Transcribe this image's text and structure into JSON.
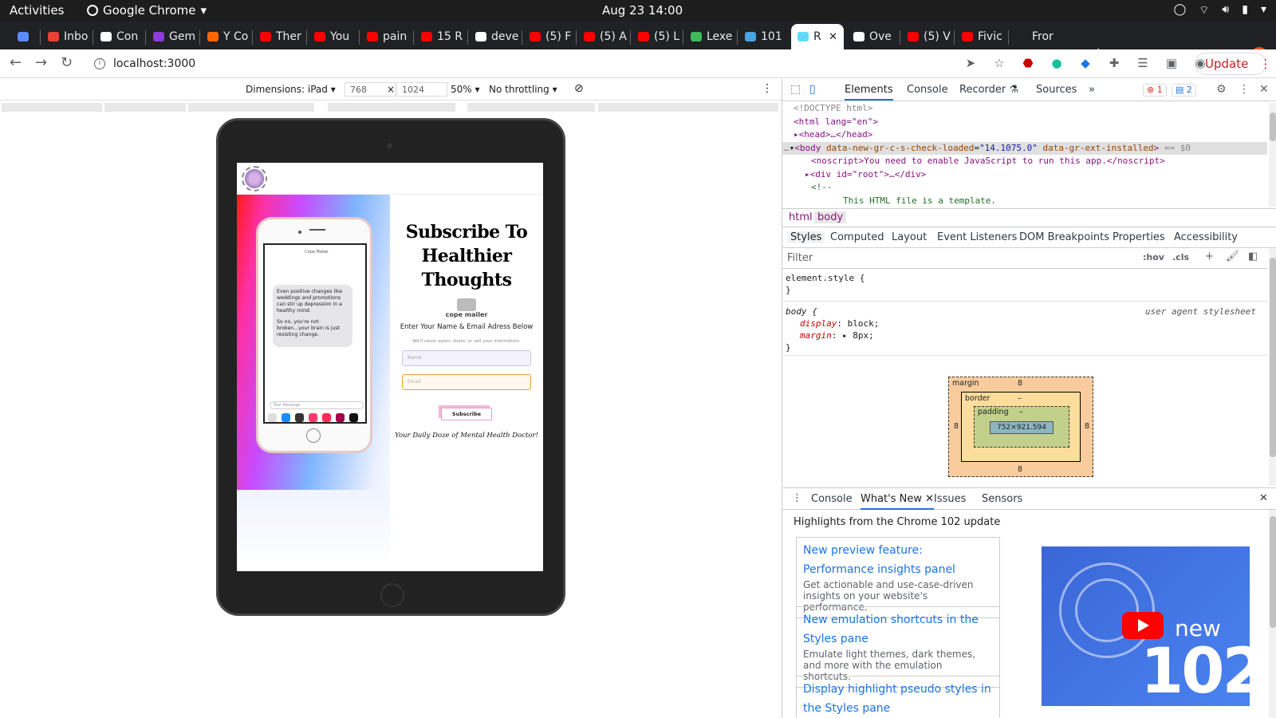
{
  "topbar": {
    "activities": "Activities",
    "app": "Google Chrome",
    "clock": "Aug 23  14:00"
  },
  "tabs": [
    {
      "label": "",
      "color": "#5a8cff"
    },
    {
      "label": "Inbo",
      "color": "#ea4335"
    },
    {
      "label": "Con",
      "color": "#ffffff"
    },
    {
      "label": "Gem",
      "color": "#8e3bd8"
    },
    {
      "label": "Y Co",
      "color": "#ff6600"
    },
    {
      "label": "Ther",
      "color": "#ff0000"
    },
    {
      "label": "You",
      "color": "#ff0000"
    },
    {
      "label": "pain",
      "color": "#ff0000"
    },
    {
      "label": "15 R",
      "color": "#ff0000"
    },
    {
      "label": "deve",
      "color": "#ffffff"
    },
    {
      "label": "(5) F",
      "color": "#ff0000"
    },
    {
      "label": "(5) A",
      "color": "#ff0000"
    },
    {
      "label": "(5) L",
      "color": "#ff0000"
    },
    {
      "label": "Lexe",
      "color": "#3dbb5c"
    },
    {
      "label": "101",
      "color": "#4aa3df"
    },
    {
      "label": "R",
      "color": "#61dafb",
      "active": true
    },
    {
      "label": "Ove",
      "color": "#ffffff"
    },
    {
      "label": "(5) V",
      "color": "#ff0000"
    },
    {
      "label": "Fivic",
      "color": "#ff0000"
    },
    {
      "label": "Fror",
      "color": "#202124"
    }
  ],
  "toolbar": {
    "url": "localhost:3000",
    "update_label": "Update"
  },
  "device": {
    "dimensions": "Dimensions: iPad",
    "width": "768",
    "height": "1024",
    "times": "×",
    "zoom": "50%",
    "throttle": "No throttling"
  },
  "app": {
    "title": "Subscribe To Healthier Thoughts",
    "brand": "cope mailer",
    "enter_label": "Enter Your Name & Email Adress Below",
    "spam_note": "We'll never spam, share, or sell your information.",
    "name_placeholder": "Name",
    "email_placeholder": "Email",
    "subscribe_label": "Subscribe",
    "tagline": "Your Daily Doze of Mental Health Doctor!",
    "phone_contact": "Cope Mailer",
    "phone_msg_1": "Even positive changes like weddings and promotions can stir up depression in a healthy mind.",
    "phone_msg_2": "So no, you're not broken...your brain is just resisting change.",
    "phone_input": "Text Message"
  },
  "devtools": {
    "tabs": [
      "Elements",
      "Console",
      "Recorder",
      "Sources"
    ],
    "errors": "1",
    "messages": "2",
    "dom": {
      "doctype": "<!DOCTYPE html>",
      "html_open": "<html lang=\"en\">",
      "head": "<head>…</head>",
      "body_tag": "<body",
      "body_attr1": "data-new-gr-c-s-check-loaded",
      "body_val1": "\"14.1075.0\"",
      "body_attr2": "data-gr-ext-installed",
      "body_close": ">",
      "body_eq": "== $0",
      "noscript": "<noscript>You need to enable JavaScript to run this app.</noscript>",
      "root_div": "<div id=\"root\">…</div>",
      "comment_open": "<!--",
      "comment_text": "This HTML file is a template."
    },
    "crumbs": [
      "html",
      "body"
    ],
    "subtabs": [
      "Styles",
      "Computed",
      "Layout",
      "Event Listeners",
      "DOM Breakpoints",
      "Properties",
      "Accessibility"
    ],
    "filter_placeholder": "Filter",
    "hov": ":hov",
    "cls": ".cls",
    "styles": {
      "element_style": "element.style {",
      "close": "}",
      "body_sel": "body {",
      "ua": "user agent stylesheet",
      "display_prop": "display",
      "display_val": "block;",
      "margin_prop": "margin",
      "margin_val": "8px;"
    },
    "boxmodel": {
      "margin": "margin",
      "margin_val": "8",
      "border": "border",
      "border_val": "–",
      "padding": "padding",
      "padding_val": "–",
      "content": "752×921.594"
    },
    "drawer_tabs": [
      "Console",
      "What's New",
      "Issues",
      "Sensors"
    ],
    "whatsnew": {
      "heading": "Highlights from the Chrome 102 update",
      "cards": [
        {
          "title": "New preview feature: Performance insights panel",
          "desc": "Get actionable and use-case-driven insights on your website's performance."
        },
        {
          "title": "New emulation shortcuts in the Styles pane",
          "desc": "Emulate light themes, dark themes, and more with the emulation shortcuts."
        },
        {
          "title": "Display highlight pseudo styles in the Styles pane",
          "desc": ""
        }
      ],
      "video_new": "new",
      "video_num": "102"
    }
  }
}
